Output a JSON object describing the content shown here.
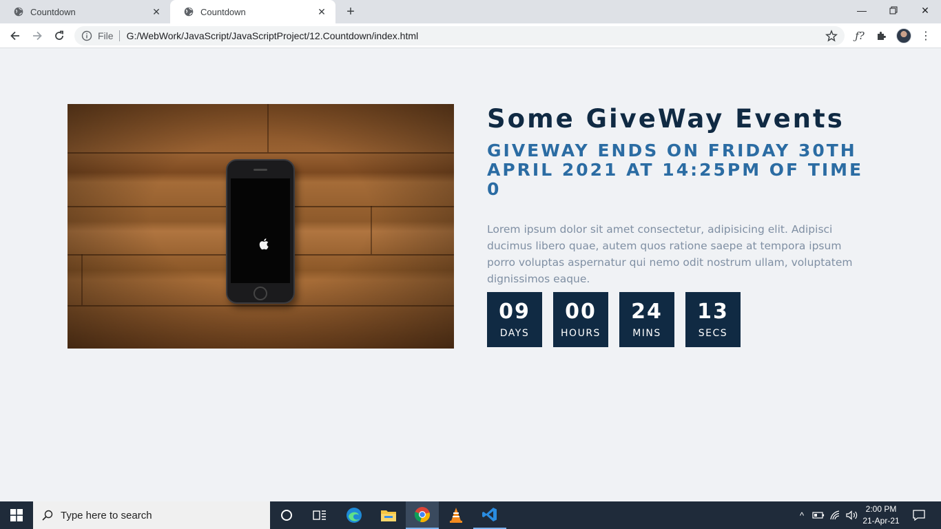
{
  "browser": {
    "tabs": [
      {
        "title": "Countdown",
        "active": false
      },
      {
        "title": "Countdown",
        "active": true
      }
    ],
    "address": {
      "scheme_label": "File",
      "url": "G:/WebWork/JavaScript/JavaScriptProject/12.Countdown/index.html"
    }
  },
  "page": {
    "title": "Some GiveWay Events",
    "subtitle": "giveway ends on friday 30th april 2021 at 14:25pm of time 0",
    "description": "Lorem ipsum dolor sit amet consectetur, adipisicing elit. Adipisci ducimus libero quae, autem quos ratione saepe at tempora ipsum porro voluptas aspernatur qui nemo odit nostrum ullam, voluptatem dignissimos eaque.",
    "countdown": [
      {
        "value": "09",
        "label": "days"
      },
      {
        "value": "00",
        "label": "hours"
      },
      {
        "value": "24",
        "label": "mins"
      },
      {
        "value": "13",
        "label": "secs"
      }
    ]
  },
  "taskbar": {
    "search_placeholder": "Type here to search",
    "time": "2:00 PM",
    "date": "21-Apr-21",
    "apps": [
      "cortana-icon",
      "task-view-icon",
      "edge-icon",
      "file-explorer-icon",
      "chrome-icon",
      "vlc-icon",
      "vscode-icon"
    ]
  },
  "colors": {
    "title": "#102a43",
    "subtitle": "#2b6ca3",
    "countdown_box": "#102a43",
    "page_bg": "#f0f2f5"
  }
}
